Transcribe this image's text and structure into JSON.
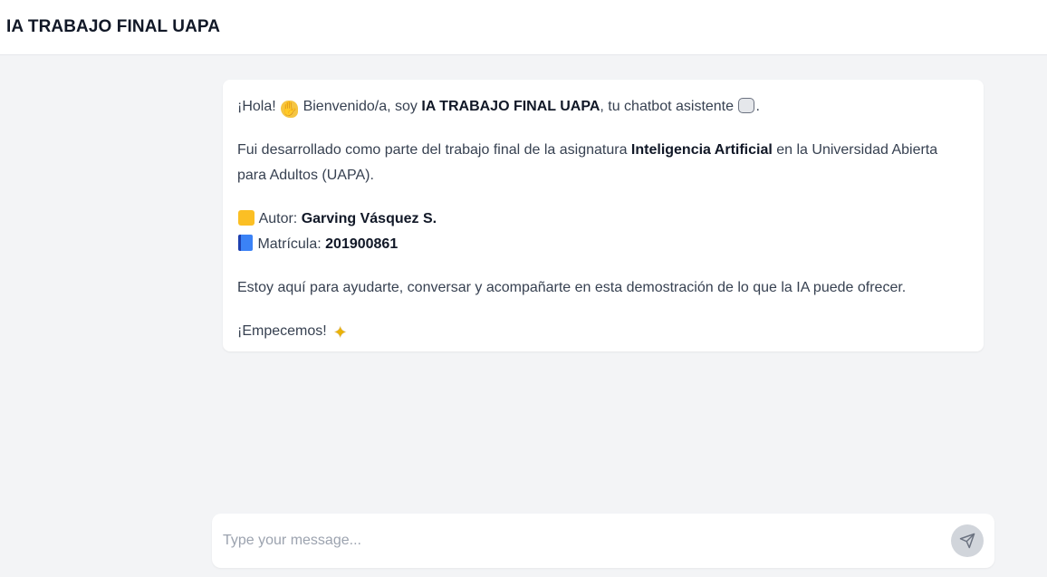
{
  "header": {
    "title": "IA TRABAJO FINAL UAPA"
  },
  "message": {
    "p1": {
      "t1": "¡Hola! ",
      "t2": " Bienvenido/a, soy ",
      "bold": "IA TRABAJO FINAL UAPA",
      "t3": ", tu chatbot asistente ",
      "t4": "."
    },
    "p2": {
      "t1": "Fui desarrollado como parte del trabajo final de la asignatura ",
      "bold": "Inteligencia Artificial",
      "t2": " en la Universidad Abierta para Adultos (UAPA)."
    },
    "author": {
      "label": " Autor: ",
      "value": "Garving Vásquez S."
    },
    "enrollment": {
      "label": " Matrícula: ",
      "value": "201900861"
    },
    "p4": "Estoy aquí para ayudarte, conversar y acompañarte en esta demostración de lo que la IA puede ofrecer.",
    "p5": "¡Empecemos! "
  },
  "icons": {
    "wave": "waving-hand-icon",
    "robot": "robot-icon",
    "student": "student-icon",
    "book": "book-icon",
    "sparkle": "sparkles-icon",
    "send": "send-icon"
  },
  "input": {
    "placeholder": "Type your message..."
  },
  "colors": {
    "background": "#f3f4f6",
    "send_button": "#d1d5db",
    "text": "#374151"
  }
}
